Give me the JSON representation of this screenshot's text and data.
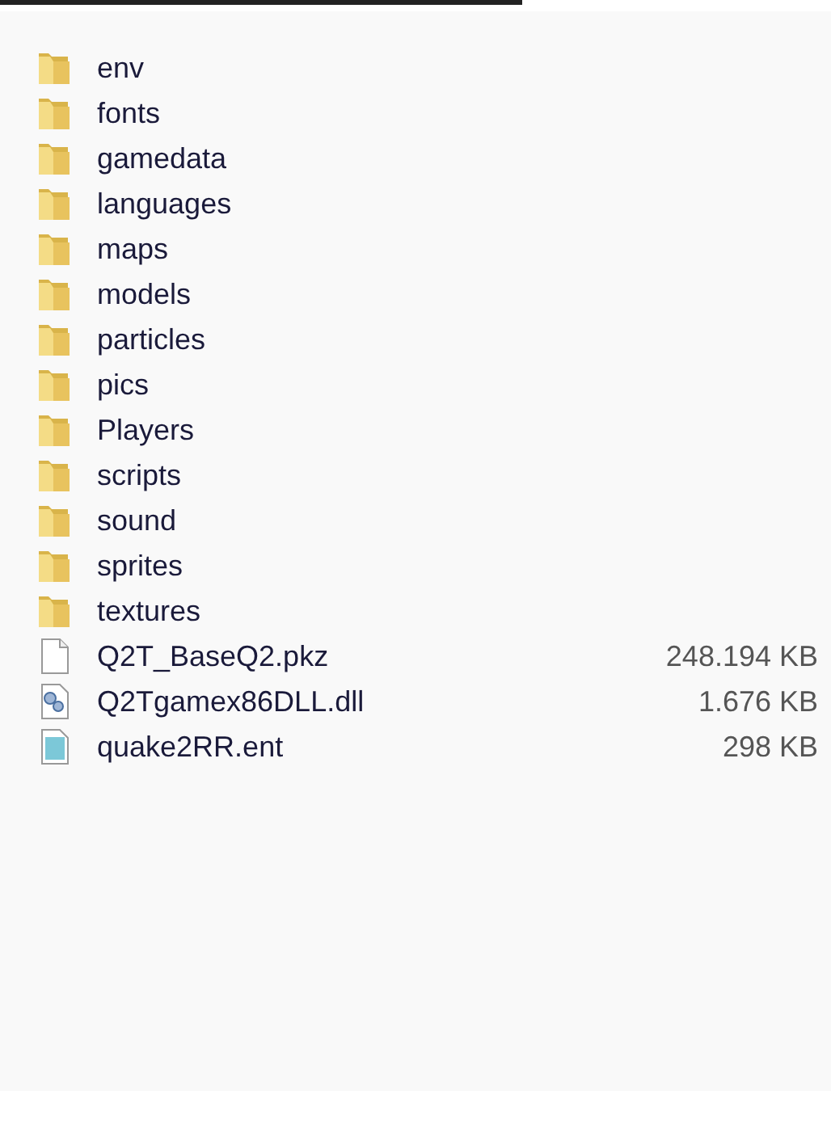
{
  "items": [
    {
      "kind": "folder",
      "name": "env"
    },
    {
      "kind": "folder",
      "name": "fonts"
    },
    {
      "kind": "folder",
      "name": "gamedata"
    },
    {
      "kind": "folder",
      "name": "languages"
    },
    {
      "kind": "folder",
      "name": "maps"
    },
    {
      "kind": "folder",
      "name": "models"
    },
    {
      "kind": "folder",
      "name": "particles"
    },
    {
      "kind": "folder",
      "name": "pics"
    },
    {
      "kind": "folder",
      "name": "Players"
    },
    {
      "kind": "folder",
      "name": "scripts"
    },
    {
      "kind": "folder",
      "name": "sound"
    },
    {
      "kind": "folder",
      "name": "sprites"
    },
    {
      "kind": "folder",
      "name": "textures"
    },
    {
      "kind": "blank",
      "name": "Q2T_BaseQ2.pkz",
      "size": "248.194 KB"
    },
    {
      "kind": "library",
      "name": "Q2Tgamex86DLL.dll",
      "size": "1.676 KB"
    },
    {
      "kind": "entity",
      "name": "quake2RR.ent",
      "size": "298 KB"
    }
  ]
}
